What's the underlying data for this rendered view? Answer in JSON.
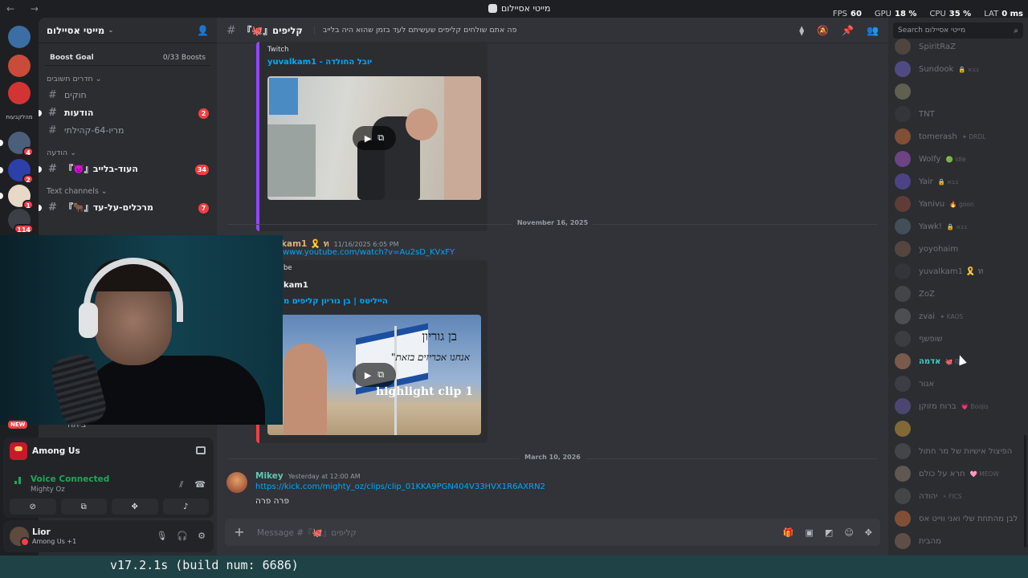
{
  "titlebar": {
    "nav": "← →",
    "title": "מייטי אסיילום",
    "stats": [
      {
        "label": "FPS",
        "value": "60"
      },
      {
        "label": "GPU",
        "value": "18 %"
      },
      {
        "label": "CPU",
        "value": "35 %"
      },
      {
        "label": "LAT",
        "value": "0 ms"
      }
    ]
  },
  "rail": {
    "servers": [
      {
        "name": "server-1",
        "badge": "",
        "color": "#3b6ea5"
      },
      {
        "name": "server-2",
        "badge": "",
        "color": "#c94b3a"
      },
      {
        "name": "server-3",
        "badge": "",
        "color": "#d23434"
      },
      {
        "name": "server-4",
        "badge": "4",
        "color": "#4b5f7a"
      },
      {
        "name": "server-5",
        "badge": "2",
        "color": "#2d3fa8"
      },
      {
        "name": "server-6",
        "badge": "1",
        "color": "#e8d8c8"
      },
      {
        "name": "server-7",
        "badge": "114",
        "color": "#3c3f45"
      }
    ],
    "text_label": "מהלקבעות",
    "new_label": "NEW"
  },
  "sidebar": {
    "server_name": "מייטי אסיילום",
    "boost_label": "Boost Goal",
    "boost_count": "0/33 Boosts",
    "categories": [
      {
        "label": "חדרים חשובים",
        "channels": [
          {
            "name": "חוקים",
            "badge": "",
            "unread": false
          },
          {
            "name": "הודעות",
            "badge": "2",
            "unread": true
          },
          {
            "name": "מריו-64-קהילתי",
            "badge": "",
            "unread": false
          }
        ]
      },
      {
        "label": "הודעה",
        "channels": [
          {
            "name": "『👿』העוד-בלייב",
            "badge": "34",
            "unread": true
          }
        ]
      },
      {
        "label": "Text channels",
        "channels": [
          {
            "name": "『🐂』מרכלים-על-עד",
            "badge": "7",
            "unread": true
          }
        ]
      }
    ],
    "hidden_channel": "ביתח"
  },
  "activity": {
    "game": "Among Us",
    "voice_title": "Voice Connected",
    "voice_server": "Mighty Oz"
  },
  "user": {
    "name": "Lior",
    "status": "Among Us +1"
  },
  "chat": {
    "channel_name": "『🐙』קליפים",
    "topic": "פה אתם שולחים קליפים שעשיתם לעד בזמן שהוא היה בלייב",
    "embed1": {
      "provider": "Twitch",
      "title": "yuvalkam1 - יובל החולדה"
    },
    "divider1": "November 16, 2025",
    "msg2": {
      "author": "kam1 🎗️ ท",
      "time": "11/16/2025 6:05 PM",
      "link": "www.youtube.com/watch?v=Au2sD_KVxFY",
      "embed_provider": "be",
      "embed_author": "kam1",
      "embed_title": "הייליטס | בן גוריון קליפים מ",
      "thumb_text1": "בן גוריון",
      "thumb_text2": "\"אנחנו אכריזים בזאת",
      "thumb_text3": "highlight clip 1"
    },
    "divider2": "March 10, 2026",
    "msg3": {
      "author": "Mikey",
      "time": "Yesterday at 12:00 AM",
      "link": "https://kick.com/mighty_oz/clips/clip_01KKA9PGN404V33HVX1R6AXRN2",
      "text": "פרה פרה"
    },
    "composer_placeholder": "Message #『🐙』קליפים"
  },
  "members": {
    "search_placeholder": "Search מייטי אסיילום",
    "list": [
      {
        "name": "SpiritRaZ",
        "status": "",
        "color": "#6c5a4a"
      },
      {
        "name": "Sundook",
        "status": "🔒 בבא",
        "color": "#6f63c9"
      },
      {
        "name": "",
        "status": "",
        "color": "#8c8a6a"
      },
      {
        "name": "TNT",
        "status": "",
        "color": "#3b3d42"
      },
      {
        "name": "tomerash",
        "status": "✦ DRDL",
        "color": "#c96a3a"
      },
      {
        "name": "Wolfy",
        "status": "🟢 idle",
        "color": "#a455c9"
      },
      {
        "name": "Yair",
        "status": "🔒 בבא",
        "color": "#6a55c9"
      },
      {
        "name": "Yanivu",
        "status": "🔥 goon",
        "color": "#8a4a3a"
      },
      {
        "name": "Yawk!",
        "status": "🔒 בבא",
        "color": "#5a6a7a"
      },
      {
        "name": "yoyohaim",
        "status": "",
        "color": "#7a5a4a"
      },
      {
        "name": "yuvalkam1 🎗️ ท",
        "status": "",
        "color": "#3b3d42"
      },
      {
        "name": "ZoZ",
        "status": "",
        "color": "#5a5a5a"
      },
      {
        "name": "zvai",
        "status": "✦ KAOS",
        "color": "#6a6a6a"
      },
      {
        "name": "שופשף",
        "status": "",
        "color": "#4a4a4a"
      },
      {
        "name": "אדמה",
        "status": "🐙 ₪",
        "color": "#7a5a4a",
        "active": true
      },
      {
        "name": "אגור",
        "status": "",
        "color": "#4a4a55"
      },
      {
        "name": "ברוח מזוקן",
        "status": "💗 Boojis",
        "color": "#6a5aa5"
      },
      {
        "name": "",
        "status": "",
        "color": "#c99a3a"
      },
      {
        "name": "הפיצול אישיות של מר חתול",
        "status": "",
        "color": "#5a5a5a"
      },
      {
        "name": "חרא על כולם",
        "status": "🩷 MEOW",
        "color": "#8a7a6a"
      },
      {
        "name": "יהודה",
        "status": "⚡ FICS",
        "color": "#5a5a5a"
      },
      {
        "name": "לבן מהתחת שלי ואני ווייט אס",
        "status": "",
        "color": "#c96a3a"
      },
      {
        "name": "מהבית",
        "status": "",
        "color": "#8a6a5a"
      }
    ]
  },
  "footer": {
    "version": "v17.2.1s (build num: 6686)"
  }
}
